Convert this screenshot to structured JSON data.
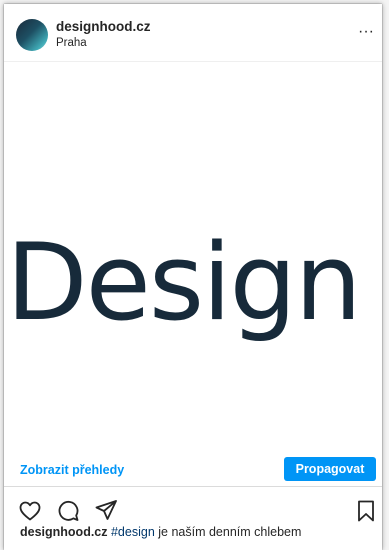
{
  "post": {
    "username": "designhood.cz",
    "location": "Praha",
    "more_label": "···",
    "image_text": "Design",
    "insights_label": "Zobrazit přehledy",
    "promote_label": "Propagovat",
    "caption": {
      "username": "designhood.cz",
      "hashtag": "#design",
      "text": "je naším denním chlebem"
    }
  },
  "icons": [
    "heart-icon",
    "comment-icon",
    "share-icon",
    "bookmark-icon"
  ],
  "colors": {
    "accent": "#0095f6",
    "text": "#262626",
    "image_text": "#172a3a",
    "hashtag": "#00376b"
  }
}
